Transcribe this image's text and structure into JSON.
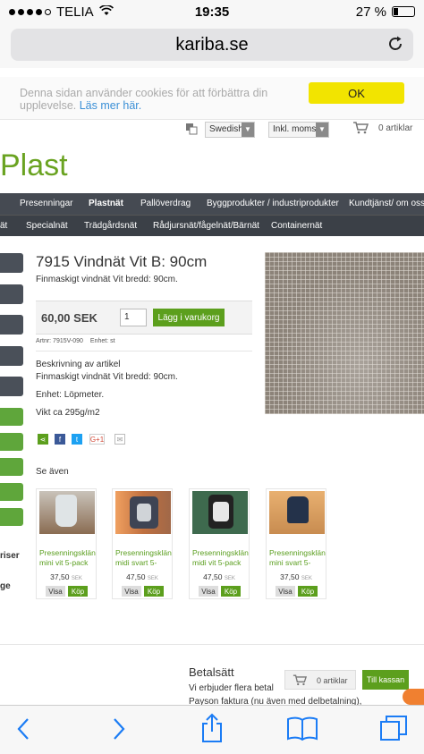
{
  "status_bar": {
    "carrier": "TELIA",
    "time": "19:35",
    "battery": "27 %"
  },
  "browser": {
    "url": "kariba.se"
  },
  "cookie": {
    "text": "Denna sidan använder cookies för att förbättra din upplevelse.",
    "link": "Läs mer här.",
    "ok": "OK"
  },
  "tools": {
    "language": "Swedish",
    "tax": "Inkl. moms",
    "cart": "0 artiklar"
  },
  "logo": "Plast",
  "nav": {
    "row1": [
      "Presenningar",
      "Plastnät",
      "Pallöverdrag",
      "Byggprodukter / industriprodukter",
      "Kundtjänst/ om oss"
    ],
    "row2": [
      "ät",
      "Specialnät",
      "Trädgårdsnät",
      "Rådjursnät/fågelnät/Bärnät",
      "Containernät"
    ]
  },
  "side": {
    "text1": "riser",
    "text2": "ge"
  },
  "product": {
    "title": "7915 Vindnät Vit B: 90cm",
    "subtitle": "Finmaskigt vindnät Vit bredd: 90cm.",
    "price": "60,00 SEK",
    "qty": "1",
    "add_to_cart": "Lägg i varukorg",
    "artnr": "Artnr: 7915V-090",
    "unit": "Enhet: st",
    "desc_heading": "Beskrivning av artikel",
    "desc_line": "Finmaskigt vindnät Vit bredd: 90cm.",
    "desc_unit": "Enhet: Löpmeter.",
    "desc_weight": "Vikt ca 295g/m2"
  },
  "see_also": {
    "heading": "Se även",
    "items": [
      {
        "name1": "Presenningsklän",
        "name2": "mini vit 5-pack",
        "price": "37,50",
        "currency": "SEK",
        "visa": "Visa",
        "kop": "Köp"
      },
      {
        "name1": "Presenningsklän",
        "name2": "midi svart 5-",
        "price": "47,50",
        "currency": "SEK",
        "visa": "Visa",
        "kop": "Köp"
      },
      {
        "name1": "Presenningsklän",
        "name2": "midi vit 5-pack",
        "price": "47,50",
        "currency": "SEK",
        "visa": "Visa",
        "kop": "Köp"
      },
      {
        "name1": "Presenningsklän",
        "name2": "mini svart 5-",
        "price": "37,50",
        "currency": "SEK",
        "visa": "Visa",
        "kop": "Köp"
      }
    ]
  },
  "footer": {
    "title": "Betalsätt",
    "text": "Vi erbjuder flera betal",
    "text2": "Payson faktura (nu även med delbetalning),",
    "cart": "0 artiklar",
    "checkout": "Till kassan"
  },
  "colors": {
    "brand_green": "#6aa321",
    "nav_bg": "#454a52",
    "cookie_button": "#f2e400",
    "button_green": "#5c9f1d"
  },
  "icons": [
    "wifi-icon",
    "reload-icon",
    "translate-icon",
    "cart-icon",
    "share-icon",
    "facebook-icon",
    "twitter-icon",
    "google-plus-icon",
    "mail-icon",
    "back-icon",
    "forward-icon",
    "share-sheet-icon",
    "bookmarks-icon",
    "tabs-icon"
  ]
}
